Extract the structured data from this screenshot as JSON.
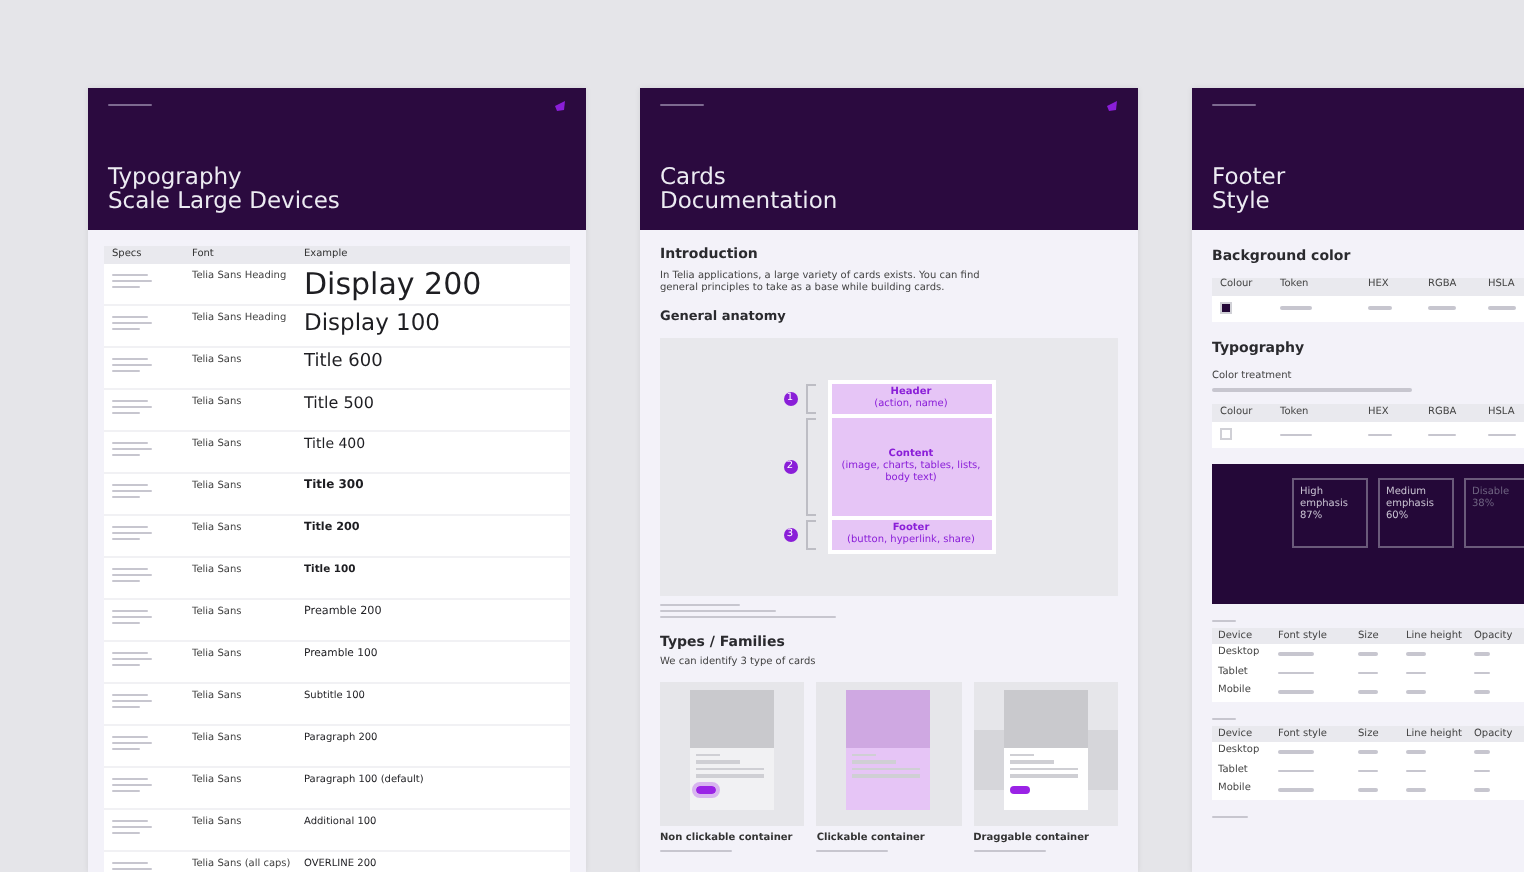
{
  "pages": [
    {
      "kind": "typography",
      "title_lines": [
        "Typography",
        "Scale Large Devices"
      ],
      "table": {
        "columns": [
          "Specs",
          "Font",
          "Example"
        ],
        "rows": [
          {
            "font": "Telia Sans Heading",
            "example": "Display 200",
            "kind": "d200"
          },
          {
            "font": "Telia Sans Heading",
            "example": "Display 100",
            "kind": "d100"
          },
          {
            "font": "Telia Sans",
            "example": "Title 600",
            "kind": "t600"
          },
          {
            "font": "Telia Sans",
            "example": "Title 500",
            "kind": "t500"
          },
          {
            "font": "Telia Sans",
            "example": "Title 400",
            "kind": "t400"
          },
          {
            "font": "Telia Sans",
            "example": "Title 300",
            "kind": "t300"
          },
          {
            "font": "Telia Sans",
            "example": "Title 200",
            "kind": "t200"
          },
          {
            "font": "Telia Sans",
            "example": "Title 100",
            "kind": "t100"
          },
          {
            "font": "Telia Sans",
            "example": "Preamble 200",
            "kind": "p200"
          },
          {
            "font": "Telia Sans",
            "example": "Preamble 100",
            "kind": "p100"
          },
          {
            "font": "Telia Sans",
            "example": "Subtitle 100",
            "kind": "small"
          },
          {
            "font": "Telia Sans",
            "example": "Paragraph 200",
            "kind": "small"
          },
          {
            "font": "Telia Sans",
            "example": "Paragraph 100 (default)",
            "kind": "small"
          },
          {
            "font": "Telia Sans",
            "example": "Additional 100",
            "kind": "small"
          },
          {
            "font": "Telia Sans (all caps)",
            "example": "OVERLINE 200",
            "kind": "small"
          }
        ]
      }
    },
    {
      "kind": "cards",
      "title_lines": [
        "Cards",
        "Documentation"
      ],
      "intro_heading": "Introduction",
      "intro_text": "In Telia applications, a large variety of cards exists. You can find general principles to take as a base while building cards.",
      "anatomy_heading": "General anatomy",
      "anatomy": [
        {
          "number": "1",
          "name": "Header",
          "detail": "(action, name)"
        },
        {
          "number": "2",
          "name": "Content",
          "detail": "(image, charts, tables, lists, body text)"
        },
        {
          "number": "3",
          "name": "Footer",
          "detail": "(button, hyperlink, share)"
        }
      ],
      "types_heading": "Types / Families",
      "types_text": "We can identify 3 type of cards",
      "types": [
        {
          "kind": "plain",
          "caption": "Non clickable container"
        },
        {
          "kind": "clickable",
          "caption": "Clickable container"
        },
        {
          "kind": "draggable",
          "caption": "Draggable container"
        }
      ]
    },
    {
      "kind": "footer",
      "title_lines": [
        "Footer",
        "Style"
      ],
      "bg_heading": "Background color",
      "color_columns": [
        "Colour",
        "Token",
        "HEX",
        "RGBA",
        "HSLA"
      ],
      "typo_heading": "Typography",
      "typo_label": "Color treatment",
      "color_columns_2": [
        "Colour",
        "Token",
        "HEX",
        "RGBA",
        "HSLA"
      ],
      "emphasis": [
        "High emphasis",
        "87%",
        "Medium emphasis",
        "60%",
        "Disable",
        "38%"
      ],
      "link_columns": [
        "Device",
        "Font style",
        "Size",
        "Line height",
        "Opacity"
      ],
      "main_links": [
        "Desktop",
        "Tablet",
        "Mobile"
      ],
      "link_columns_2": [
        "Device",
        "Font style",
        "Size",
        "Line height",
        "Opacity"
      ],
      "sub_links": [
        "Desktop",
        "Tablet",
        "Mobile"
      ]
    }
  ]
}
